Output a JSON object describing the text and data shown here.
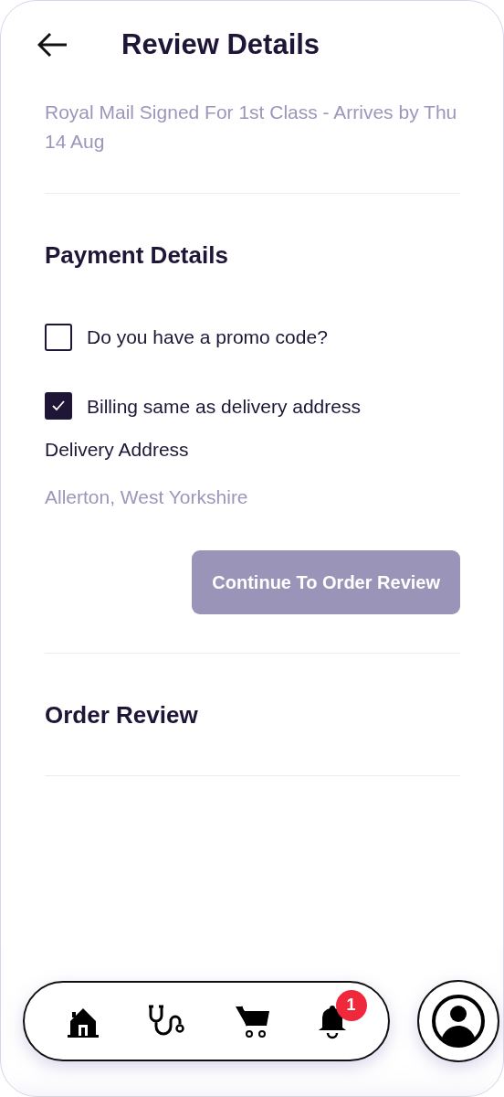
{
  "header": {
    "title": "Review Details"
  },
  "delivery": {
    "speed": "Royal Mail Signed For 1st Class - Arrives by Thu 14 Aug"
  },
  "payment": {
    "title": "Payment Details",
    "options": [
      {
        "label": "Do you have a promo code?",
        "checked": false
      },
      {
        "label": "Billing same as delivery address",
        "checked": true
      }
    ],
    "address_label": "Delivery Address",
    "address": "Allerton, West Yorkshire",
    "button": "Continue To Order Review"
  },
  "order_review": {
    "title": "Order Review"
  },
  "nav": {
    "items": [
      {
        "kind": "home"
      },
      {
        "kind": "stethoscope"
      },
      {
        "kind": "cart"
      },
      {
        "kind": "bell",
        "badge": "1"
      }
    ]
  }
}
